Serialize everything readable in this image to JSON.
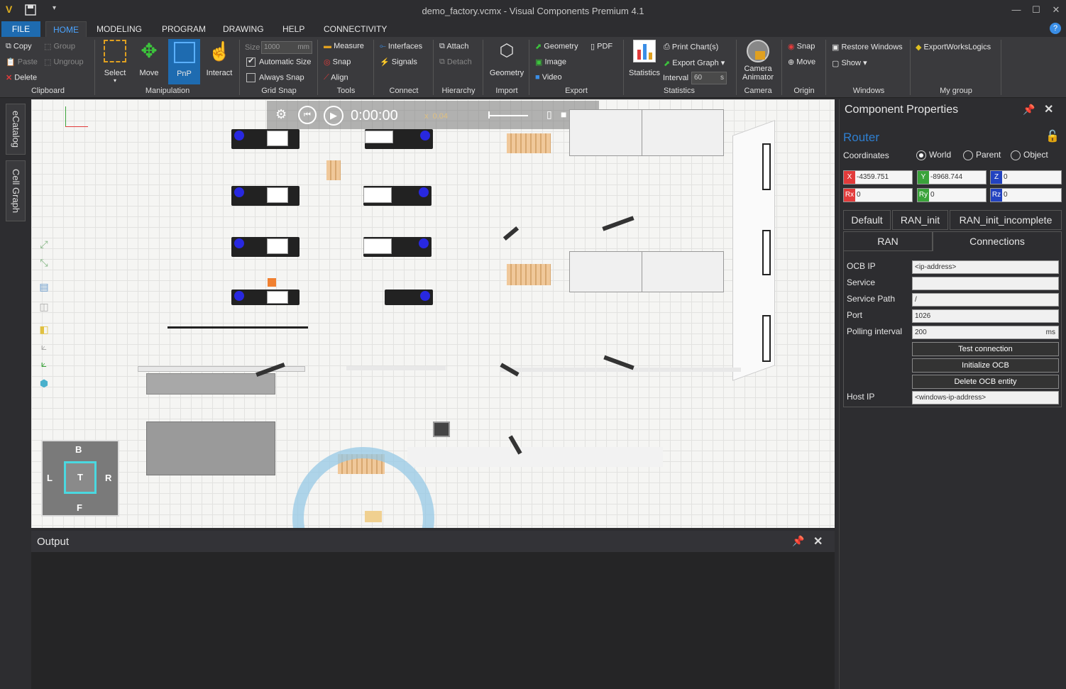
{
  "window": {
    "title": "demo_factory.vcmx - Visual Components Premium 4.1"
  },
  "menu": [
    "FILE",
    "HOME",
    "MODELING",
    "PROGRAM",
    "DRAWING",
    "HELP",
    "CONNECTIVITY"
  ],
  "ribbon": {
    "clipboard": {
      "copy": "Copy",
      "paste": "Paste",
      "delete": "Delete",
      "group": "Group",
      "ungroup": "Ungroup",
      "label": "Clipboard"
    },
    "manipulation": {
      "select": "Select",
      "move": "Move",
      "pnp": "PnP",
      "interact": "Interact",
      "label": "Manipulation"
    },
    "grid_snap": {
      "size_label": "Size",
      "size_value": "1000",
      "size_unit": "mm",
      "automatic_size": "Automatic Size",
      "always_snap": "Always Snap",
      "label": "Grid Snap"
    },
    "tools": {
      "measure": "Measure",
      "snap": "Snap",
      "align": "Align",
      "label": "Tools"
    },
    "connect": {
      "interfaces": "Interfaces",
      "signals": "Signals",
      "label": "Connect"
    },
    "hierarchy": {
      "attach": "Attach",
      "detach": "Detach",
      "label": "Hierarchy"
    },
    "import": {
      "geometry": "Geometry",
      "label": "Import"
    },
    "export": {
      "geometry": "Geometry",
      "pdf": "PDF",
      "image": "Image",
      "video": "Video",
      "label": "Export"
    },
    "statistics": {
      "statistics": "Statistics",
      "print_charts": "Print Chart(s)",
      "export_graph": "Export Graph",
      "interval_label": "Interval",
      "interval_value": "60",
      "interval_unit": "s",
      "label": "Statistics"
    },
    "camera": {
      "animator_line1": "Camera",
      "animator_line2": "Animator",
      "label": "Camera"
    },
    "origin": {
      "snap": "Snap",
      "move": "Move",
      "label": "Origin"
    },
    "windows": {
      "restore": "Restore Windows",
      "show": "Show",
      "label": "Windows"
    },
    "my_group": {
      "export_works_logics": "ExportWorksLogics",
      "label": "My group"
    }
  },
  "side_tabs": [
    "eCatalog",
    "Cell Graph"
  ],
  "playback": {
    "time": "0:00:00",
    "speed_prefix": "x",
    "speed": "0.04"
  },
  "nav_cube": {
    "top": "T",
    "back": "B",
    "front": "F",
    "left": "L",
    "right": "R"
  },
  "output": {
    "title": "Output"
  },
  "properties": {
    "panel_title": "Component Properties",
    "component_name": "Router",
    "coordinates_label": "Coordinates",
    "coord_modes": [
      "World",
      "Parent",
      "Object"
    ],
    "selected_mode": "World",
    "x": {
      "label": "X",
      "value": "-4359.751"
    },
    "y": {
      "label": "Y",
      "value": "-8968.744"
    },
    "z": {
      "label": "Z",
      "value": "0"
    },
    "rx": {
      "label": "Rx",
      "value": "0"
    },
    "ry": {
      "label": "Ry",
      "value": "0"
    },
    "rz": {
      "label": "Rz",
      "value": "0"
    },
    "tabs_row1": [
      "Default",
      "RAN_init",
      "RAN_init_incomplete"
    ],
    "tabs_row2": [
      "RAN",
      "Connections"
    ],
    "active_tab": "Connections",
    "fields": {
      "ocb_ip": {
        "label": "OCB IP",
        "value": "<ip-address>"
      },
      "service": {
        "label": "Service",
        "value": ""
      },
      "service_path": {
        "label": "Service Path",
        "value": "/"
      },
      "port": {
        "label": "Port",
        "value": "1026"
      },
      "polling_interval": {
        "label": "Polling interval",
        "value": "200",
        "unit": "ms"
      },
      "host_ip": {
        "label": "Host IP",
        "value": "<windows-ip-address>"
      }
    },
    "buttons": {
      "test": "Test connection",
      "init": "Initialize OCB",
      "delete": "Delete OCB entity"
    }
  },
  "colors": {
    "accent": "#1e6bb0",
    "x_axis": "#e23b3b",
    "y_axis": "#3aa33a",
    "z_axis": "#2343c0",
    "background": "#2d2d30"
  }
}
